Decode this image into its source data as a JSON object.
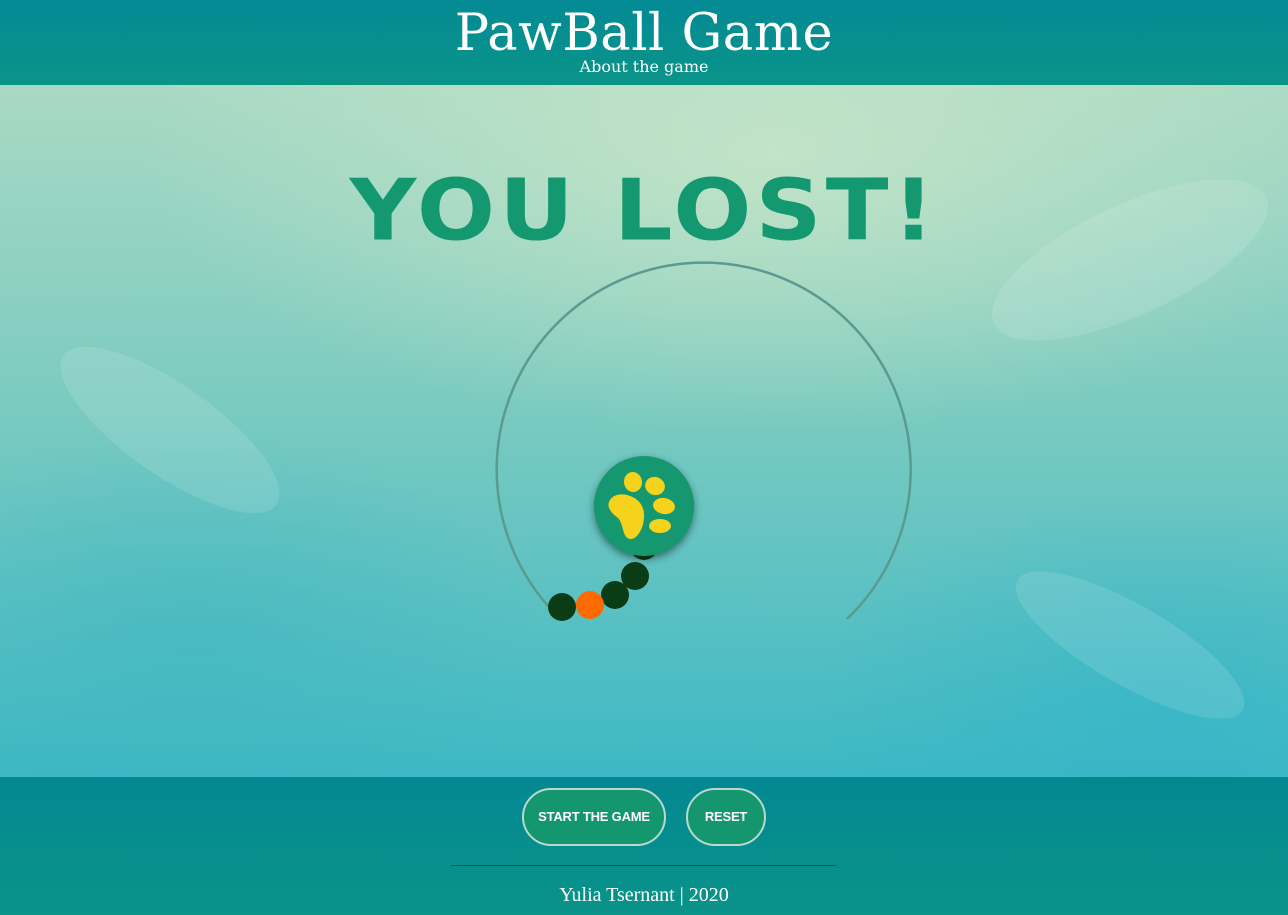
{
  "header": {
    "title": "PawBall Game",
    "about_link": "About the game"
  },
  "game": {
    "status_text": "YOU LOST!",
    "center_icon": "paw-icon",
    "ball_count": 5,
    "highlighted_ball_color": "#ff6a00",
    "ball_color": "#0a3d16",
    "track_color": "#5a9a90"
  },
  "controls": {
    "start_label": "START THE GAME",
    "reset_label": "RESET"
  },
  "footer": {
    "credit": "Yulia Tsernant | 2020"
  },
  "colors": {
    "header_bg": "#038a95",
    "accent": "#14976f",
    "paw_yellow": "#f5d21c"
  }
}
